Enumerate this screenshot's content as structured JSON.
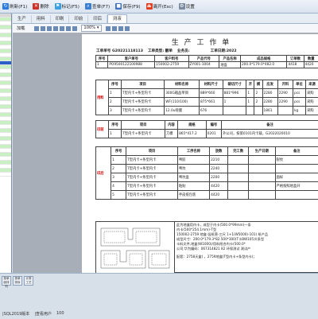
{
  "toolbar": {
    "items": [
      {
        "label": "刷新(F1)",
        "icon": "refresh-icon",
        "color": "#2a7be0"
      },
      {
        "label": "删除",
        "icon": "delete-icon",
        "color": "#d0302a"
      },
      {
        "label": "标记(F5)",
        "icon": "flag-icon",
        "color": "#3aa0e0"
      },
      {
        "label": "查单(F7)",
        "icon": "search-icon",
        "color": "#3c7fd0"
      },
      {
        "label": "保存(F9)",
        "icon": "save-icon",
        "color": "#4070c0"
      },
      {
        "label": "离开(Esc)",
        "icon": "exit-icon",
        "color": "#e04020"
      },
      {
        "label": "设置",
        "icon": "gear-icon",
        "color": "#7a8ba0"
      }
    ]
  },
  "tabs": [
    "生产",
    "用料",
    "印刷",
    "印前",
    "印后",
    "测液"
  ],
  "print_toolbar": {
    "load_label": "加载",
    "zoom": "100%"
  },
  "sheet": {
    "title": "生 产 工 作 单",
    "order_no_label": "工单单号",
    "order_no": "G20221118113",
    "type_label": "工单类型:",
    "type": "翻单",
    "salesman_label": "业务员:",
    "salesman": "",
    "date_label": "工单日期:",
    "date": "2022"
  },
  "table1": {
    "headers": [
      "序号",
      "客户单号",
      "客户料号",
      "产品代号",
      "产品名称",
      "成品规格",
      "订单数",
      "数量"
    ],
    "row": [
      "1",
      "PO9500122100988",
      "150002-2759",
      "ZY001-1004",
      "地盒",
      "200.0*179.0*482.0",
      "4418",
      "4420"
    ]
  },
  "table2": {
    "side_label": "用料",
    "headers": [
      "序号",
      "项目",
      "材料名称",
      "材料尺寸",
      "裁切尺寸",
      "开",
      "模",
      "应发",
      "开料",
      "单位",
      "来源"
    ],
    "rows": [
      [
        "1",
        "T型内卡+条型内卡",
        "300G箱品单铜",
        "889*660",
        "881*996",
        "1",
        "2",
        "2280",
        "2290",
        "pcs",
        "采购"
      ],
      [
        "2",
        "T型内卡+条型内卡",
        "WF(110/100)",
        "875*661",
        "1",
        "1",
        "2",
        "2280",
        "2290",
        "pcs",
        "采购"
      ],
      [
        "3",
        "T型内卡+条型内卡",
        "12.0u哑膜",
        "676",
        "",
        "",
        "",
        "1861",
        "",
        "kg",
        "采购"
      ]
    ]
  },
  "table3": {
    "side_label": "印前",
    "headers": [
      "序号",
      "项目",
      "内容",
      "规格",
      "编号",
      "备注"
    ],
    "row": [
      "1",
      "T型内卡+条型内卡",
      "刀模",
      "865*417.2",
      "0201",
      "外公司，按第0101内卡裁，G2022020010"
    ]
  },
  "table4": {
    "side_label": "印后",
    "headers": [
      "序号",
      "项目",
      "工序名称",
      "放数",
      "完工数",
      "生产日期",
      "备注"
    ],
    "rows": [
      [
        "1",
        "T型内卡+条型内卡",
        "啤胶",
        "2210",
        "",
        "",
        "裂纹"
      ],
      [
        "2",
        "T型内卡+条型内卡",
        "啤坑",
        "2240",
        "",
        "",
        ""
      ],
      [
        "3",
        "T型内卡+条型内卡",
        "啤坑盒",
        "2200",
        "",
        "",
        "面样"
      ],
      [
        "4",
        "T型内卡+条型内卡",
        "粘贴",
        "4420",
        "",
        "",
        "严格按照地盒开"
      ],
      [
        "5",
        "T型内卡+条型内卡",
        "手皮纸包装",
        "4420",
        "",
        "",
        ""
      ]
    ]
  },
  "notes": {
    "lines": [
      "此为地盒用内卡，成型于内卡(500.0*99mm)一条",
      "内卡(500*254.1mm)-T型",
      "150002-2759 地盒-竖纸营-三尺 1+1(W5000)-101) 纸产品",
      "成型尺寸：200.0*179.3*82.500*300(T卡BW105)/(条型",
      "卡料文件,地盒(W1000)/用料纸合内卡(500.0*",
      "公司:华为编码：067314821 82 环保测试 测试产",
      "",
      "配套：2758天盒) ，2759地盒(T型内卡+条型内卡)；"
    ]
  },
  "statusbar": {
    "buttons": [
      "按单面排列",
      "按单排序",
      "计算工艺"
    ],
    "db_label": "|SQL2019版本",
    "user_label": "|查看用户",
    "count": "100"
  }
}
